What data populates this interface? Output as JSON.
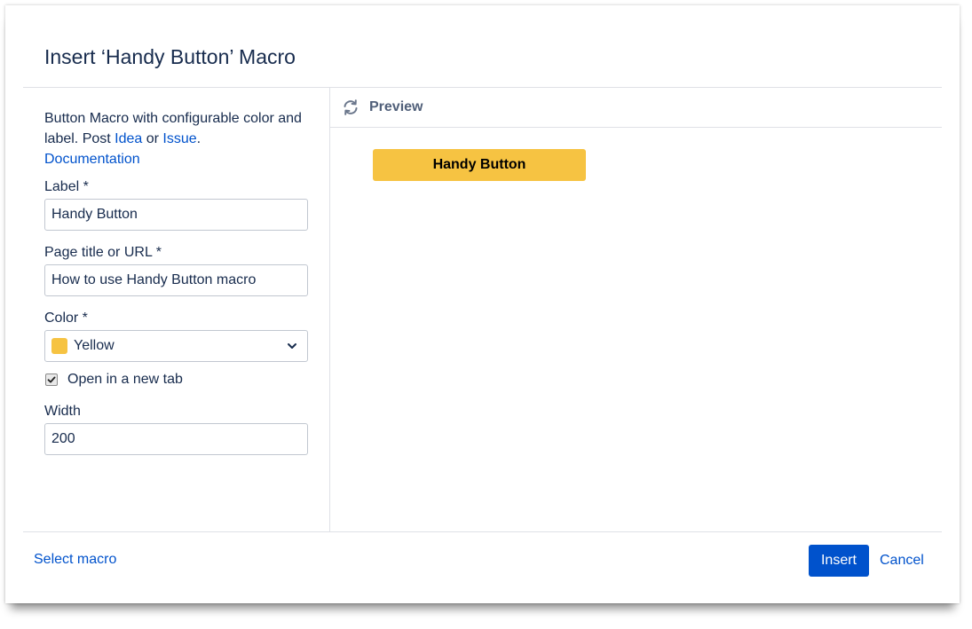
{
  "dialog": {
    "title": "Insert ‘Handy Button’ Macro"
  },
  "description": {
    "text_before": "Button Macro with configurable color and label. Post ",
    "idea_link": "Idea",
    "or_text": " or ",
    "issue_link": "Issue",
    "period": ".",
    "documentation_link": "Documentation"
  },
  "form": {
    "label_field": {
      "label": "Label *",
      "value": "Handy Button"
    },
    "page_field": {
      "label": "Page title or URL *",
      "value": "How to use Handy Button macro"
    },
    "color_field": {
      "label": "Color *",
      "value": "Yellow",
      "swatch_color": "#f6c342",
      "icon": "chevron-down-icon"
    },
    "new_tab": {
      "label": "Open in a new tab",
      "checked": true
    },
    "width_field": {
      "label": "Width",
      "value": "200"
    }
  },
  "preview": {
    "title": "Preview",
    "icon": "refresh-icon",
    "button_label": "Handy Button",
    "button_color": "#f6c342"
  },
  "footer": {
    "select_macro": "Select macro",
    "insert": "Insert",
    "cancel": "Cancel",
    "insert_color": "#0052cc"
  }
}
